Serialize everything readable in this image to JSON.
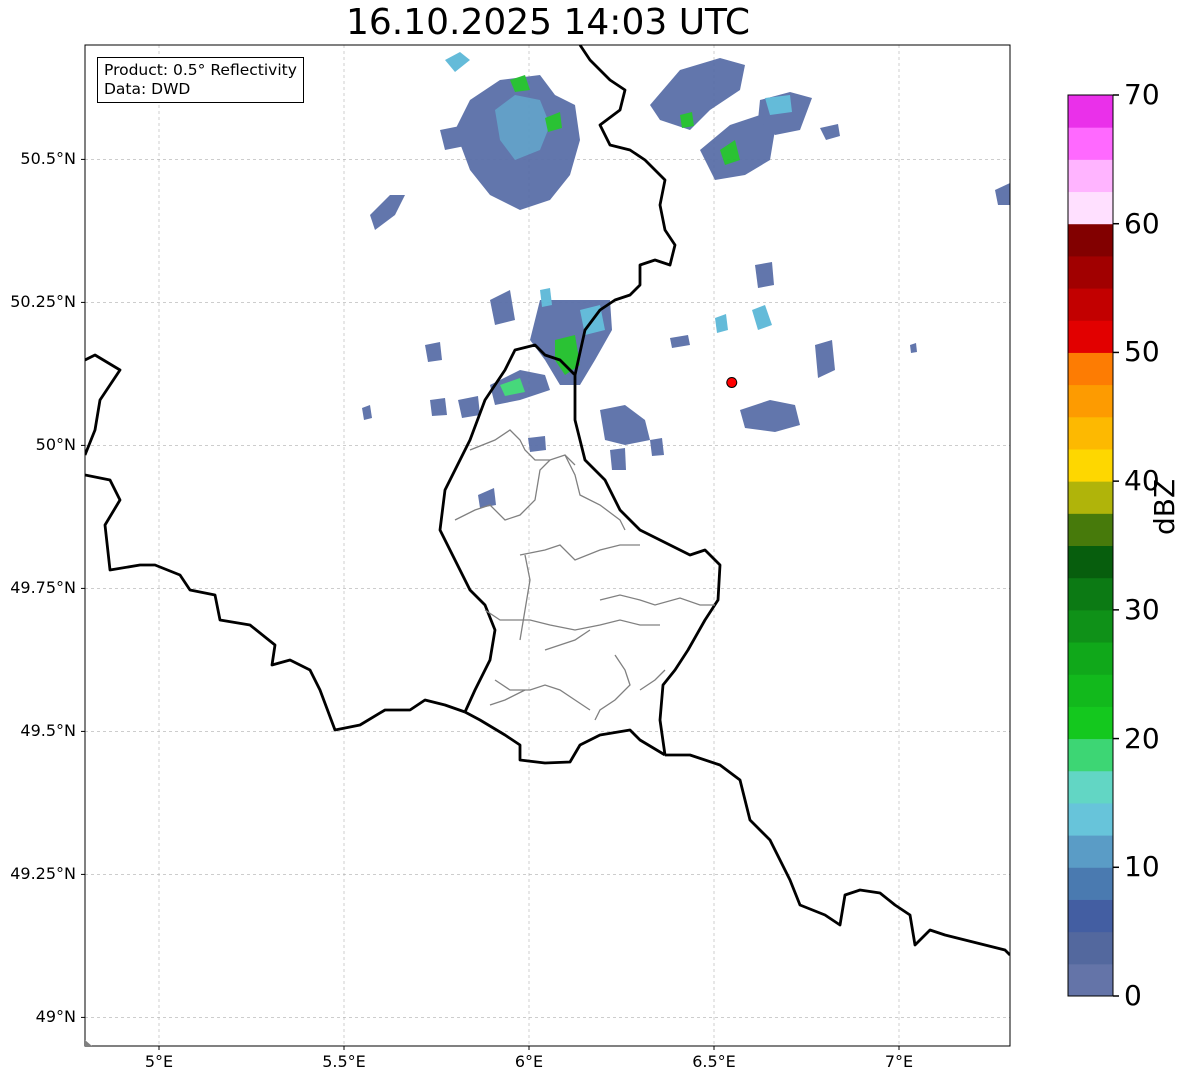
{
  "title": "16.10.2025 14:03 UTC",
  "info": {
    "product": "Product: 0.5° Reflectivity",
    "data": "Data: DWD"
  },
  "map": {
    "lon_min": 4.8,
    "lon_max": 7.3,
    "lat_min": 48.95,
    "lat_max": 50.7,
    "x_ticks": [
      {
        "value": 5.0,
        "label": "5°E"
      },
      {
        "value": 5.5,
        "label": "5.5°E"
      },
      {
        "value": 6.0,
        "label": "6°E"
      },
      {
        "value": 6.5,
        "label": "6.5°E"
      },
      {
        "value": 7.0,
        "label": "7°E"
      }
    ],
    "y_ticks": [
      {
        "value": 50.5,
        "label": "50.5°N"
      },
      {
        "value": 50.25,
        "label": "50.25°N"
      },
      {
        "value": 50.0,
        "label": "50°N"
      },
      {
        "value": 49.75,
        "label": "49.75°N"
      },
      {
        "value": 49.5,
        "label": "49.5°N"
      },
      {
        "value": 49.25,
        "label": "49.25°N"
      },
      {
        "value": 49.0,
        "label": "49°N"
      }
    ],
    "grid": true,
    "radar_site": {
      "lon": 6.548,
      "lat": 50.11,
      "color": "#ff0000"
    }
  },
  "colorbar": {
    "unit": "dBZ",
    "min": 0,
    "max": 70,
    "step": 2.5,
    "tick_values": [
      0,
      10,
      20,
      30,
      40,
      50,
      60,
      70
    ],
    "tick_labels": [
      "0",
      "10",
      "20",
      "30",
      "40",
      "50",
      "60",
      "70"
    ],
    "colors": [
      "#6474a8",
      "#53689e",
      "#435ea2",
      "#4a7ab0",
      "#5a9cc6",
      "#67c4da",
      "#62d6c4",
      "#3dd674",
      "#14c81e",
      "#12b91c",
      "#10a81a",
      "#0f9118",
      "#0c7a14",
      "#075e0d",
      "#477a0b",
      "#b0b40a",
      "#fed700",
      "#fdb901",
      "#fd9b01",
      "#fd7c03",
      "#e20000",
      "#c20000",
      "#a10000",
      "#820000",
      "#ffe0ff",
      "#ffb4ff",
      "#ff69ff",
      "#ea30ea"
    ]
  },
  "layer_colors": {
    "border": "#000000",
    "district": "#808080",
    "echo_low": "#5a6fa8",
    "echo_mid": "#5cb8d8",
    "echo_high": "#1fbf2a"
  }
}
